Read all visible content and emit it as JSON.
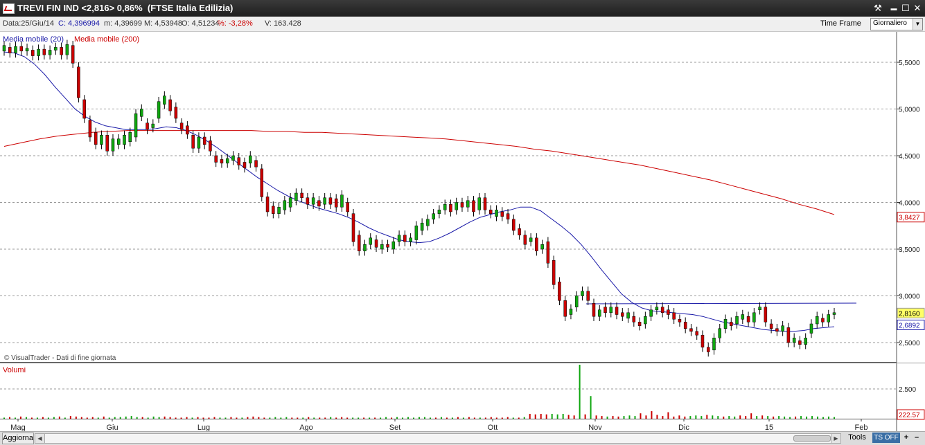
{
  "window": {
    "title": "TREVI FIN IND <2,816> 0,86%  (FTSE Italia Edilizia)",
    "controls": {
      "settings": "⚒",
      "minimize": "▬",
      "maximize": "☐",
      "close": "✕"
    }
  },
  "infobar": {
    "date": "Data:25/Giu/14",
    "close": "C: 4,396994",
    "min": "m: 4,39699",
    "max": "M: 4,53948",
    "open": "O: 4,51234",
    "pct": "%: -3,28%",
    "volume": "V: 163.428",
    "timeframe_label": "Time Frame",
    "timeframe_value": "Giornaliero"
  },
  "legend": {
    "ma20": "Media mobile (20)",
    "ma200": "Media mobile (200)",
    "copyright": "© VisualTrader - Dati di fine giornata",
    "volume_title": "Volumi"
  },
  "colors": {
    "up": "#0fa60f",
    "down": "#cc0000",
    "ma20": "#1a1aa8",
    "ma200": "#cc0000",
    "resistance": "#1a1aa8"
  },
  "chart_data": {
    "type": "candlestick",
    "price_axis": {
      "ticks": [
        "5,5000",
        "5,0000",
        "4,5000",
        "4,0000",
        "3,5000",
        "3,0000",
        "2,5000"
      ],
      "ylim": [
        2.3,
        5.85
      ]
    },
    "volume_axis": {
      "ticks": [
        "2.500"
      ]
    },
    "labels": {
      "ma200_last": "3,8427",
      "last_price": "2,8160",
      "ma20_last": "2,6892",
      "volume_last": "222.57"
    },
    "months": [
      "Mag",
      "Giu",
      "Lug",
      "Ago",
      "Set",
      "Ott",
      "Nov",
      "Dic",
      "15",
      "Feb"
    ],
    "ma20": [
      5.61,
      5.6,
      5.56,
      5.48,
      5.37,
      5.24,
      5.12,
      5.0,
      4.92,
      4.86,
      4.82,
      4.8,
      4.78,
      4.78,
      4.78,
      4.79,
      4.81,
      4.8,
      4.77,
      4.72,
      4.66,
      4.59,
      4.51,
      4.43,
      4.35,
      4.27,
      4.2,
      4.13,
      4.07,
      4.02,
      3.98,
      3.94,
      3.91,
      3.88,
      3.84,
      3.79,
      3.73,
      3.68,
      3.64,
      3.6,
      3.58,
      3.57,
      3.58,
      3.62,
      3.67,
      3.73,
      3.79,
      3.84,
      3.87,
      3.9,
      3.92,
      3.95,
      3.95,
      3.91,
      3.83,
      3.75,
      3.66,
      3.55,
      3.42,
      3.28,
      3.15,
      3.02,
      2.93,
      2.87,
      2.84,
      2.83,
      2.82,
      2.81,
      2.8,
      2.78,
      2.75,
      2.72,
      2.7,
      2.68,
      2.66,
      2.64,
      2.63,
      2.62,
      2.62,
      2.63,
      2.65,
      2.66,
      2.67
    ],
    "ma200": [
      4.6,
      4.64,
      4.68,
      4.71,
      4.73,
      4.75,
      4.76,
      4.77,
      4.77,
      4.77,
      4.77,
      4.77,
      4.77,
      4.77,
      4.77,
      4.76,
      4.76,
      4.75,
      4.75,
      4.74,
      4.73,
      4.72,
      4.71,
      4.7,
      4.69,
      4.68,
      4.66,
      4.64,
      4.62,
      4.6,
      4.57,
      4.55,
      4.52,
      4.49,
      4.46,
      4.43,
      4.4,
      4.36,
      4.32,
      4.28,
      4.24,
      4.19,
      4.14,
      4.09,
      4.04,
      3.98,
      3.93,
      3.87
    ],
    "resistance": {
      "from": "Nov",
      "to": "Feb",
      "value": 2.9
    },
    "candles": [
      [
        5.62,
        5.68
      ],
      [
        5.66,
        5.6
      ],
      [
        5.6,
        5.67
      ],
      [
        5.67,
        5.62
      ],
      [
        5.62,
        5.65
      ],
      [
        5.63,
        5.57
      ],
      [
        5.57,
        5.64
      ],
      [
        5.64,
        5.58
      ],
      [
        5.58,
        5.63
      ],
      [
        5.63,
        5.66
      ],
      [
        5.66,
        5.58
      ],
      [
        5.58,
        5.69
      ],
      [
        5.68,
        5.49
      ],
      [
        5.45,
        5.12
      ],
      [
        5.1,
        4.9
      ],
      [
        4.88,
        4.7
      ],
      [
        4.75,
        4.62
      ],
      [
        4.62,
        4.72
      ],
      [
        4.72,
        4.55
      ],
      [
        4.55,
        4.68
      ],
      [
        4.62,
        4.68
      ],
      [
        4.62,
        4.72
      ],
      [
        4.65,
        4.75
      ],
      [
        4.7,
        4.95
      ],
      [
        4.92,
        5.0
      ],
      [
        4.85,
        4.78
      ],
      [
        4.8,
        4.84
      ],
      [
        4.9,
        5.08
      ],
      [
        5.05,
        5.14
      ],
      [
        5.1,
        4.98
      ],
      [
        5.02,
        4.9
      ],
      [
        4.85,
        4.78
      ],
      [
        4.82,
        4.73
      ],
      [
        4.72,
        4.58
      ],
      [
        4.58,
        4.7
      ],
      [
        4.7,
        4.62
      ],
      [
        4.66,
        4.55
      ],
      [
        4.5,
        4.43
      ],
      [
        4.46,
        4.42
      ],
      [
        4.42,
        4.47
      ],
      [
        4.45,
        4.5
      ],
      [
        4.48,
        4.4
      ],
      [
        4.43,
        4.37
      ],
      [
        4.42,
        4.5
      ],
      [
        4.45,
        4.38
      ],
      [
        4.36,
        4.06
      ],
      [
        4.06,
        3.9
      ],
      [
        3.96,
        3.88
      ],
      [
        3.88,
        3.95
      ],
      [
        3.92,
        4.02
      ],
      [
        3.95,
        4.05
      ],
      [
        4.02,
        4.1
      ],
      [
        4.1,
        4.05
      ],
      [
        4.05,
        3.98
      ],
      [
        3.98,
        4.05
      ],
      [
        4.02,
        3.96
      ],
      [
        3.98,
        4.05
      ],
      [
        4.05,
        3.98
      ],
      [
        4.04,
        3.95
      ],
      [
        3.95,
        4.08
      ],
      [
        4.0,
        3.9
      ],
      [
        3.88,
        3.58
      ],
      [
        3.65,
        3.48
      ],
      [
        3.48,
        3.55
      ],
      [
        3.55,
        3.62
      ],
      [
        3.6,
        3.52
      ],
      [
        3.5,
        3.55
      ],
      [
        3.55,
        3.52
      ],
      [
        3.5,
        3.58
      ],
      [
        3.58,
        3.65
      ],
      [
        3.65,
        3.58
      ],
      [
        3.58,
        3.62
      ],
      [
        3.6,
        3.75
      ],
      [
        3.7,
        3.78
      ],
      [
        3.75,
        3.82
      ],
      [
        3.82,
        3.88
      ],
      [
        3.88,
        3.92
      ],
      [
        3.92,
        3.98
      ],
      [
        3.98,
        3.9
      ],
      [
        3.92,
        4.0
      ],
      [
        4.0,
        3.95
      ],
      [
        3.95,
        4.02
      ],
      [
        4.02,
        3.9
      ],
      [
        3.92,
        4.05
      ],
      [
        4.05,
        3.92
      ],
      [
        3.92,
        3.88
      ],
      [
        3.85,
        3.92
      ],
      [
        3.9,
        3.85
      ],
      [
        3.88,
        3.82
      ],
      [
        3.82,
        3.7
      ],
      [
        3.72,
        3.65
      ],
      [
        3.65,
        3.55
      ],
      [
        3.58,
        3.62
      ],
      [
        3.62,
        3.48
      ],
      [
        3.5,
        3.55
      ],
      [
        3.58,
        3.35
      ],
      [
        3.38,
        3.12
      ],
      [
        3.15,
        2.95
      ],
      [
        2.95,
        2.78
      ],
      [
        2.8,
        2.86
      ],
      [
        2.88,
        3.0
      ],
      [
        3.0,
        3.05
      ],
      [
        3.05,
        2.95
      ],
      [
        2.92,
        2.78
      ],
      [
        2.78,
        2.85
      ],
      [
        2.88,
        2.82
      ],
      [
        2.82,
        2.88
      ],
      [
        2.88,
        2.8
      ],
      [
        2.82,
        2.78
      ],
      [
        2.76,
        2.82
      ],
      [
        2.78,
        2.72
      ],
      [
        2.72,
        2.68
      ],
      [
        2.7,
        2.78
      ],
      [
        2.78,
        2.85
      ],
      [
        2.85,
        2.88
      ],
      [
        2.88,
        2.82
      ],
      [
        2.85,
        2.8
      ],
      [
        2.82,
        2.75
      ],
      [
        2.75,
        2.72
      ],
      [
        2.72,
        2.65
      ],
      [
        2.65,
        2.62
      ],
      [
        2.62,
        2.58
      ],
      [
        2.58,
        2.45
      ],
      [
        2.45,
        2.4
      ],
      [
        2.42,
        2.55
      ],
      [
        2.55,
        2.65
      ],
      [
        2.65,
        2.75
      ],
      [
        2.72,
        2.68
      ],
      [
        2.7,
        2.78
      ],
      [
        2.75,
        2.8
      ],
      [
        2.78,
        2.72
      ],
      [
        2.72,
        2.82
      ],
      [
        2.85,
        2.88
      ],
      [
        2.88,
        2.72
      ],
      [
        2.7,
        2.65
      ],
      [
        2.65,
        2.62
      ],
      [
        2.62,
        2.68
      ],
      [
        2.66,
        2.5
      ],
      [
        2.5,
        2.55
      ],
      [
        2.52,
        2.48
      ],
      [
        2.48,
        2.55
      ],
      [
        2.6,
        2.7
      ],
      [
        2.7,
        2.78
      ],
      [
        2.76,
        2.72
      ],
      [
        2.72,
        2.8
      ],
      [
        2.8,
        2.82
      ]
    ],
    "volumes": [
      0.02,
      0.03,
      0.02,
      0.04,
      0.03,
      0.02,
      0.02,
      0.03,
      0.02,
      0.03,
      0.04,
      0.02,
      0.05,
      0.04,
      0.03,
      0.02,
      0.03,
      0.02,
      0.04,
      0.02,
      0.03,
      0.03,
      0.04,
      0.05,
      0.03,
      0.03,
      0.02,
      0.04,
      0.03,
      0.04,
      0.03,
      0.02,
      0.02,
      0.03,
      0.02,
      0.03,
      0.02,
      0.02,
      0.03,
      0.02,
      0.02,
      0.03,
      0.02,
      0.02,
      0.03,
      0.04,
      0.03,
      0.02,
      0.02,
      0.03,
      0.02,
      0.03,
      0.02,
      0.02,
      0.02,
      0.03,
      0.02,
      0.02,
      0.02,
      0.03,
      0.02,
      0.03,
      0.02,
      0.02,
      0.02,
      0.02,
      0.02,
      0.02,
      0.02,
      0.03,
      0.02,
      0.03,
      0.02,
      0.03,
      0.02,
      0.03,
      0.03,
      0.02,
      0.02,
      0.03,
      0.02,
      0.02,
      0.03,
      0.02,
      0.03,
      0.02,
      0.02,
      0.02,
      0.03,
      0.02,
      0.02,
      0.03,
      0.02,
      0.02,
      0.03,
      0.09,
      0.08,
      0.09,
      0.08,
      0.09,
      0.08,
      0.09,
      0.07,
      0.06,
      1.0,
      0.08,
      0.42,
      0.06,
      0.05,
      0.04,
      0.05,
      0.04,
      0.05,
      0.06,
      0.05,
      0.1,
      0.06,
      0.14,
      0.07,
      0.05,
      0.12,
      0.04,
      0.06,
      0.04,
      0.05,
      0.06,
      0.05,
      0.07,
      0.06,
      0.05,
      0.04,
      0.05,
      0.04,
      0.06,
      0.05,
      0.1,
      0.05,
      0.06,
      0.05,
      0.04,
      0.05,
      0.04,
      0.03,
      0.04,
      0.05,
      0.04,
      0.05,
      0.04,
      0.03,
      0.04,
      0.03
    ]
  }
}
